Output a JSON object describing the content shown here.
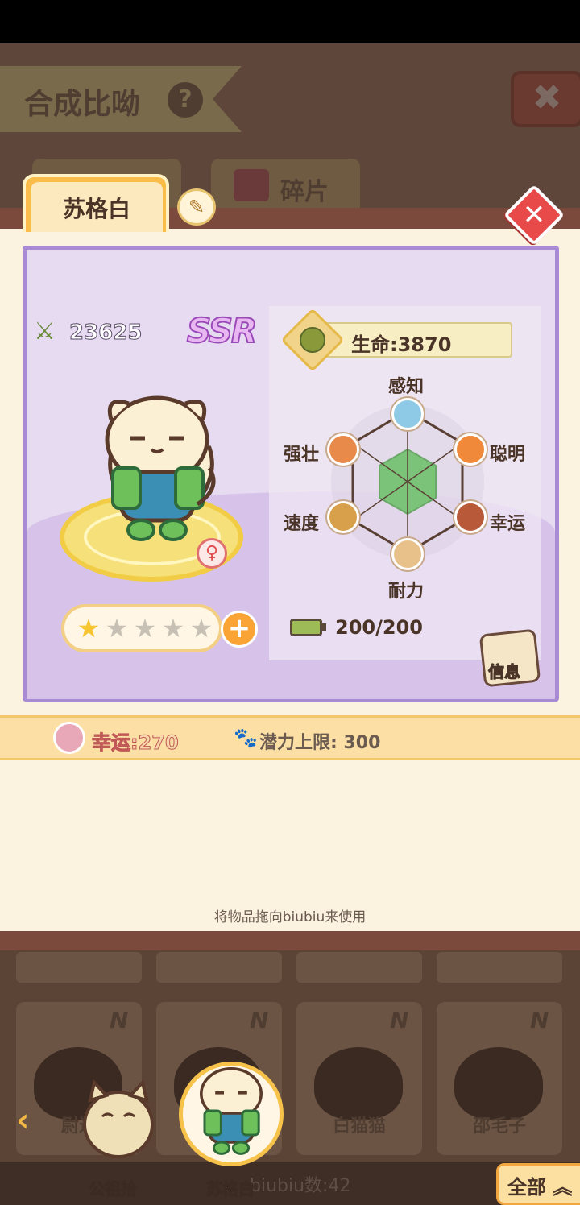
{
  "header": {
    "title": "合成比呦",
    "help_label": "?",
    "close_label": "✖",
    "tab_fragments_label": "碎片"
  },
  "pet": {
    "name": "苏格白",
    "edit_icon": "pencil-icon",
    "rarity": "SSR",
    "power": "23625",
    "life": "生命:3870",
    "gender_symbol": "♀",
    "stars_filled": 1,
    "stars_total": 5,
    "stamina": "200/200",
    "info_label": "信息"
  },
  "attributes": {
    "top": "感知",
    "upper_right": "聪明",
    "lower_right": "幸运",
    "bottom": "耐力",
    "lower_left": "速度",
    "upper_left": "强壮"
  },
  "strip": {
    "luck": "幸运:270",
    "potential": "潜力上限: 300"
  },
  "hint": "将物品拖向biubiu来使用",
  "roster": {
    "slots": [
      {
        "rank": "N",
        "name": "尉迟"
      },
      {
        "rank": "N",
        "name": ""
      },
      {
        "rank": "N",
        "name": "白猫猫"
      },
      {
        "rank": "N",
        "name": "邵毛子"
      }
    ],
    "team": [
      {
        "name": "公祖拾"
      },
      {
        "name": "苏格白"
      }
    ],
    "count": "biubiu数:42",
    "all_label": "全部"
  },
  "colors": {
    "card_border": "#a98ad4",
    "panel_bg": "#fbf2e0",
    "accent_orange": "#f9a435",
    "hex_fill": "#7cc37a"
  }
}
